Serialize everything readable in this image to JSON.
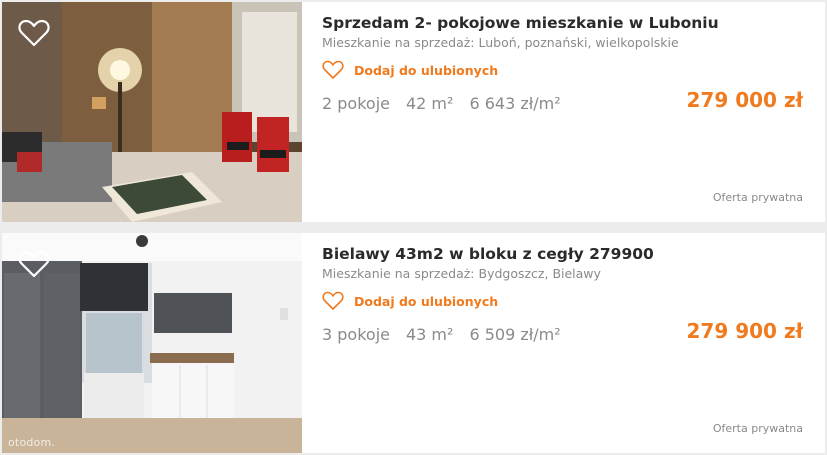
{
  "listings": [
    {
      "title": "Sprzedam 2- pokojowe mieszkanie w Luboniu",
      "location": "Mieszkanie na sprzedaż: Luboń, poznański, wielkopolskie",
      "favorite_label": "Dodaj do ulubionych",
      "rooms": "2 pokoje",
      "area": "42 m²",
      "price_per_m2": "6 643 zł/m²",
      "price": "279 000 zł",
      "seller": "Oferta prywatna",
      "photo_icon": "living-room-photo",
      "watermark": ""
    },
    {
      "title": "Bielawy 43m2 w bloku z cegły 279900",
      "location": "Mieszkanie na sprzedaż: Bydgoszcz, Bielawy",
      "favorite_label": "Dodaj do ulubionych",
      "rooms": "3 pokoje",
      "area": "43 m²",
      "price_per_m2": "6 509 zł/m²",
      "price": "279 900 zł",
      "seller": "Oferta prywatna",
      "photo_icon": "kitchen-photo",
      "watermark": "otodom."
    }
  ],
  "colors": {
    "accent": "#f07a1e",
    "title": "#2a2a2a",
    "muted": "#8a8a8a",
    "background": "#ececec"
  },
  "icons": {
    "favorite": "heart-icon"
  }
}
